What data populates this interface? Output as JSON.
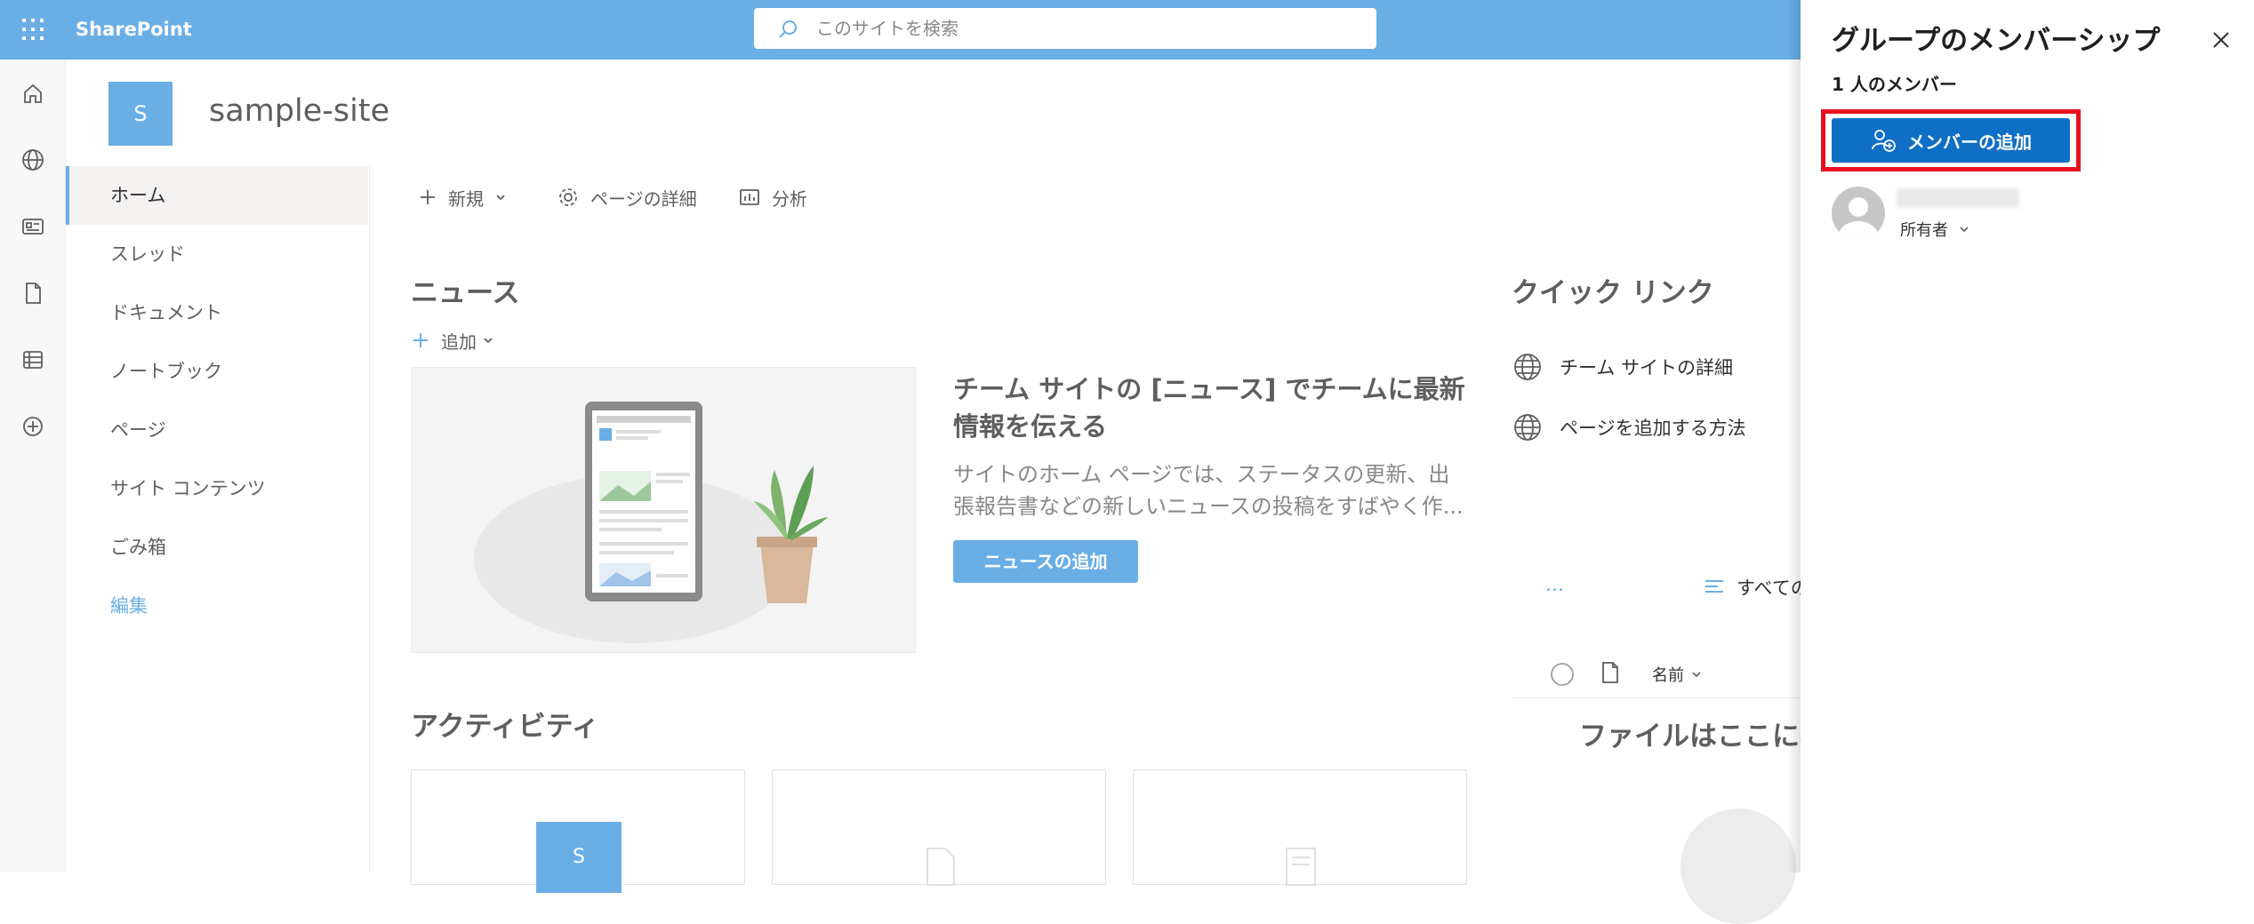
{
  "suite_bar": {
    "app_name": "SharePoint",
    "search_placeholder": "このサイトを検索",
    "background": "#6aaee6"
  },
  "site": {
    "logo_letter": "S",
    "title": "sample-site"
  },
  "nav": {
    "items": [
      {
        "label": "ホーム",
        "active": true
      },
      {
        "label": "スレッド"
      },
      {
        "label": "ドキュメント"
      },
      {
        "label": "ノートブック"
      },
      {
        "label": "ページ"
      },
      {
        "label": "サイト コンテンツ"
      },
      {
        "label": "ごみ箱"
      },
      {
        "label": "編集"
      }
    ]
  },
  "command_bar": {
    "new_label": "新規",
    "details_label": "ページの詳細",
    "analytics_label": "分析"
  },
  "news": {
    "title": "ニュース",
    "add_label": "追加",
    "heading": "チーム サイトの [ニュース] でチームに最新情報を伝える",
    "description": "サイトのホーム ページでは、ステータスの更新、出張報告書などの新しいニュースの投稿をすばやく作...",
    "button_label": "ニュースの追加"
  },
  "activity": {
    "title": "アクティビティ",
    "card_letter": "S"
  },
  "quick_links": {
    "title": "クイック リンク",
    "items": [
      {
        "label": "チーム サイトの詳細",
        "icon": "globe-icon"
      },
      {
        "label": "ページを追加する方法",
        "icon": "globe-icon"
      }
    ]
  },
  "documents": {
    "more": "...",
    "all_label": "すべての",
    "name_header": "名前",
    "empty_text": "ファイルはここに表"
  },
  "member_panel": {
    "title": "グループのメンバーシップ",
    "count_label": "1 人のメンバー",
    "add_member_label": "メンバーの追加",
    "member_role": "所有者",
    "highlight_color": "#e8101f",
    "button_color": "#0f6fc6"
  }
}
